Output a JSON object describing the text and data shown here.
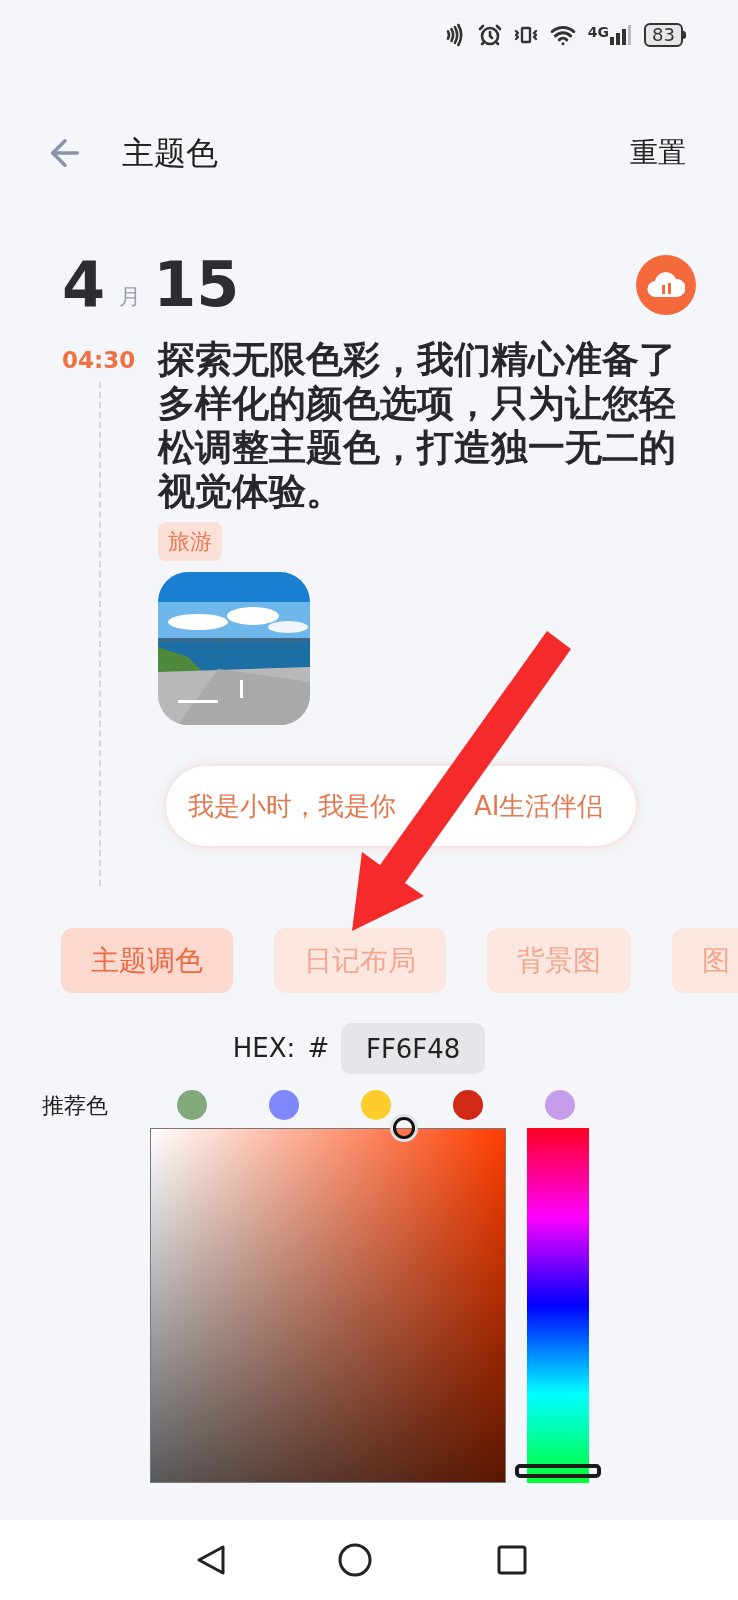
{
  "status_bar": {
    "network": "4G",
    "battery": "83"
  },
  "header": {
    "title": "主题色",
    "action": "重置"
  },
  "date": {
    "month": "4",
    "month_unit": "月",
    "day": "15"
  },
  "entry": {
    "time": "04:30",
    "text": "探索无限色彩，我们精心准备了多样化的颜色选项，只为让您轻松调整主题色，打造独一无二的视觉体验。",
    "tag": "旅游"
  },
  "assistant_bubble": {
    "texts": [
      "我是小时，我是你",
      "AI生活伴侣"
    ]
  },
  "tabs": [
    {
      "label": "主题调色",
      "selected": true
    },
    {
      "label": "日记布局",
      "selected": false
    },
    {
      "label": "背景图",
      "selected": false
    },
    {
      "label": "图",
      "selected": false
    }
  ],
  "hex": {
    "label": "HEX:",
    "prefix": "#",
    "value": "FF6F48"
  },
  "recommended": {
    "label": "推荐色",
    "colors": [
      {
        "color": "#82a97c"
      },
      {
        "color": "#8087fb"
      },
      {
        "color": "#fccd2c"
      },
      {
        "color": "#d02a16"
      },
      {
        "color": "#c59ee9"
      }
    ]
  }
}
